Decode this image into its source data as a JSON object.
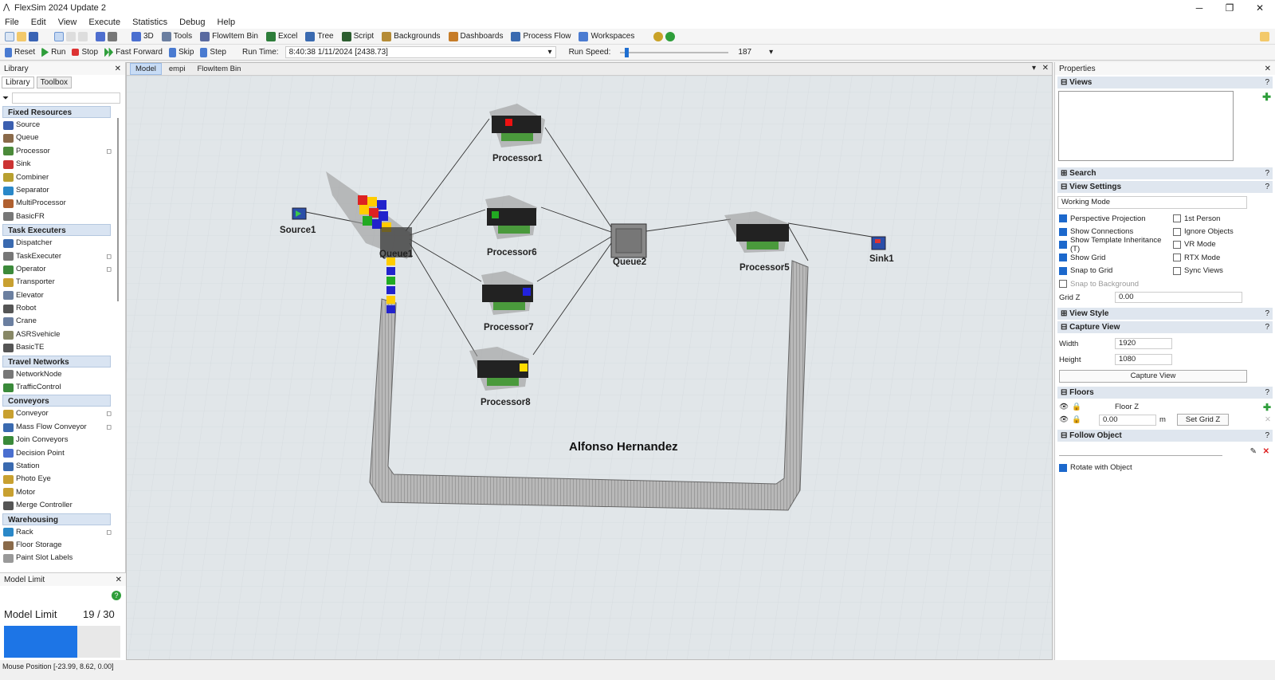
{
  "app": {
    "title": "FlexSim 2024 Update 2"
  },
  "menu": [
    "File",
    "Edit",
    "View",
    "Execute",
    "Statistics",
    "Debug",
    "Help"
  ],
  "toolbar": {
    "items": [
      "3D",
      "Tools",
      "FlowItem Bin",
      "Excel",
      "Tree",
      "Script",
      "Backgrounds",
      "Dashboards",
      "Process Flow",
      "Workspaces"
    ]
  },
  "runbar": {
    "reset": "Reset",
    "run": "Run",
    "stop": "Stop",
    "fast_forward": "Fast Forward",
    "skip": "Skip",
    "step": "Step",
    "run_time_label": "Run Time:",
    "run_time_value": "8:40:38  1/11/2024  [2438.73]",
    "run_speed_label": "Run Speed:",
    "run_speed_value": "187",
    "speed_fraction": 0.04
  },
  "library": {
    "title": "Library",
    "tabs": [
      "Library",
      "Toolbox"
    ],
    "categories": [
      {
        "name": "Fixed Resources",
        "items": [
          "Source",
          "Queue",
          "Processor",
          "Sink",
          "Combiner",
          "Separator",
          "MultiProcessor",
          "BasicFR"
        ]
      },
      {
        "name": "Task Executers",
        "items": [
          "Dispatcher",
          "TaskExecuter",
          "Operator",
          "Transporter",
          "Elevator",
          "Robot",
          "Crane",
          "ASRSvehicle",
          "BasicTE"
        ]
      },
      {
        "name": "Travel Networks",
        "items": [
          "NetworkNode",
          "TrafficControl"
        ]
      },
      {
        "name": "Conveyors",
        "items": [
          "Conveyor",
          "Mass Flow Conveyor",
          "Join Conveyors",
          "Decision Point",
          "Station",
          "Photo Eye",
          "Motor",
          "Merge Controller"
        ]
      },
      {
        "name": "Warehousing",
        "items": [
          "Rack",
          "Floor Storage",
          "Paint Slot Labels"
        ]
      }
    ]
  },
  "model_limit": {
    "title": "Model Limit",
    "label": "Model Limit",
    "value": "19 / 30",
    "fraction": 0.633
  },
  "view": {
    "tabs": [
      "Model",
      "empi",
      "FlowItem Bin"
    ],
    "objects": {
      "source1": "Source1",
      "queue1": "Queue1",
      "processor1": "Processor1",
      "processor6": "Processor6",
      "processor7": "Processor7",
      "processor8": "Processor8",
      "queue2": "Queue2",
      "processor5": "Processor5",
      "sink1": "Sink1"
    },
    "annotation": "Alfonso Hernandez"
  },
  "properties": {
    "title": "Properties",
    "sections": {
      "views": "Views",
      "search": "Search",
      "view_settings": "View Settings",
      "view_style": "View Style",
      "capture_view": "Capture View",
      "floors": "Floors",
      "follow_object": "Follow Object"
    },
    "working_mode": "Working Mode",
    "checks_left": [
      {
        "label": "Perspective Projection",
        "on": true
      },
      {
        "label": "Show Connections",
        "on": true
      },
      {
        "label": "Show Template Inheritance (T)",
        "on": true
      },
      {
        "label": "Show Grid",
        "on": true
      },
      {
        "label": "Snap to Grid",
        "on": true
      },
      {
        "label": "Snap to Background",
        "on": false
      }
    ],
    "checks_right": [
      {
        "label": "1st Person",
        "on": false
      },
      {
        "label": "Ignore Objects",
        "on": false
      },
      {
        "label": "VR Mode",
        "on": false
      },
      {
        "label": "RTX Mode",
        "on": false
      },
      {
        "label": "Sync Views",
        "on": false
      }
    ],
    "grid_z_label": "Grid Z",
    "grid_z_value": "0.00",
    "width_label": "Width",
    "width_value": "1920",
    "height_label": "Height",
    "height_value": "1080",
    "capture_button": "Capture View",
    "floor_name": "Floor Z",
    "floor_z": "0.00",
    "floor_unit": "m",
    "set_grid_button": "Set Grid Z",
    "rotate_with_object": "Rotate with Object"
  },
  "status": {
    "mouse_position": "Mouse Position [-23.99, 8.62, 0.00]"
  }
}
